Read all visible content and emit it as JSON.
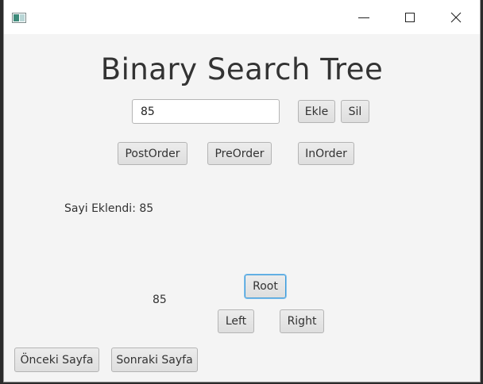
{
  "app": {
    "title": "Binary Search Tree"
  },
  "input": {
    "value": "85"
  },
  "buttons": {
    "add": "Ekle",
    "remove": "Sil",
    "postorder": "PostOrder",
    "preorder": "PreOrder",
    "inorder": "InOrder",
    "root": "Root",
    "left": "Left",
    "right": "Right",
    "prev_page": "Önceki Sayfa",
    "next_page": "Sonraki Sayfa"
  },
  "status": {
    "message": "Sayi Eklendi: 85"
  },
  "node": {
    "value": "85"
  },
  "colors": {
    "focus": "#3a9ad9",
    "window_bg": "#f4f4f4"
  }
}
